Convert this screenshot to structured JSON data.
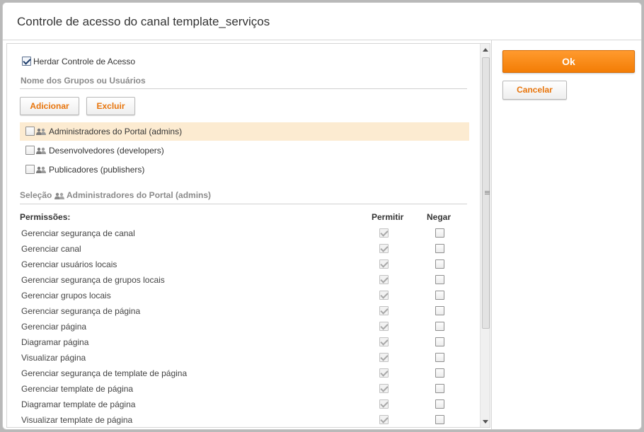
{
  "dialog": {
    "title": "Controle de acesso do canal template_serviços"
  },
  "inherit": {
    "label": "Herdar Controle de Acesso",
    "checked": true
  },
  "groups_section": {
    "heading": "Nome dos Grupos ou Usuários",
    "add_label": "Adicionar",
    "delete_label": "Excluir",
    "items": [
      {
        "label": "Administradores do Portal (admins)",
        "selected": true,
        "icon": "users-icon"
      },
      {
        "label": "Desenvolvedores (developers)",
        "selected": false,
        "icon": "users-icon"
      },
      {
        "label": "Publicadores (publishers)",
        "selected": false,
        "icon": "users-icon"
      }
    ]
  },
  "selection": {
    "prefix": "Seleção",
    "value": "Administradores do Portal (admins)"
  },
  "permissions": {
    "heading": "Permissões:",
    "allow_header": "Permitir",
    "deny_header": "Negar",
    "rows": [
      {
        "label": "Gerenciar segurança de canal"
      },
      {
        "label": "Gerenciar canal"
      },
      {
        "label": "Gerenciar usuários locais"
      },
      {
        "label": "Gerenciar segurança de grupos locais"
      },
      {
        "label": "Gerenciar grupos locais"
      },
      {
        "label": "Gerenciar segurança de página"
      },
      {
        "label": "Gerenciar página"
      },
      {
        "label": "Diagramar página"
      },
      {
        "label": "Visualizar página"
      },
      {
        "label": "Gerenciar segurança de template de página"
      },
      {
        "label": "Gerenciar template de página"
      },
      {
        "label": "Diagramar template de página"
      },
      {
        "label": "Visualizar template de página"
      }
    ]
  },
  "actions": {
    "ok_label": "Ok",
    "cancel_label": "Cancelar"
  },
  "colors": {
    "accent": "#f58a13",
    "selected_row": "#fcebd1",
    "link_orange": "#e8750c"
  }
}
